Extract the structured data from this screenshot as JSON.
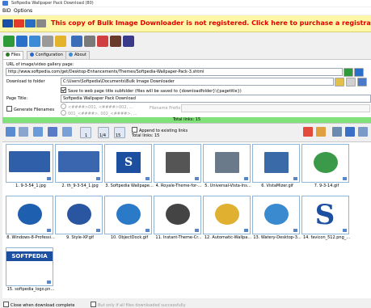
{
  "window": {
    "title": "Softpedia Wallpaper Pack Download (80)"
  },
  "menu": [
    "BID",
    "Options"
  ],
  "banner": {
    "message": "This copy of Bulk Image Downloader is not registered. Click here to purchase a registration code."
  },
  "tabs": [
    {
      "label": "Files"
    },
    {
      "label": "Configuration"
    },
    {
      "label": "About"
    }
  ],
  "form": {
    "url_label": "URL of image/video gallery page:",
    "url_value": "http://www.softpedia.com/get/Desktop-Enhancements/Themes/Softpedia-Wallpaper-Pack-3.shtml",
    "folder_label": "Download to folder",
    "folder_value": "C:\\Users\\Softpedia\\Documents\\Bulk Image Downloader",
    "subfolder_label": "Save to web page title subfolder (files will be saved to {downloadfolder}\\{pagetitle})",
    "page_title_label": "Page Title:",
    "page_title_value": "Softpedia Wallpaper Pack Download",
    "gen_label": "Generate Filenames",
    "opt1": "<####>001, <####>002, ...",
    "opt2": "001_<####>, 002_<####>, ...",
    "prefix_label": "Filename Prefix:"
  },
  "total_links": "Total links: 15",
  "view": {
    "append_label": "Append to existing links",
    "total_label": "Total links: 15",
    "n1": "1",
    "n2": "1/4",
    "n3": "15"
  },
  "thumbs": [
    {
      "caption": "1. 9-3-54_1.jpg"
    },
    {
      "caption": "2. th_9-3-54_1.jpg"
    },
    {
      "caption": "3. Softpedia Wallpape..."
    },
    {
      "caption": "4. Royale-Theme-for-..."
    },
    {
      "caption": "5. Universal-Vista-Ins..."
    },
    {
      "caption": "6. VistaMizer.gif"
    },
    {
      "caption": "7. 9-3-14.gif"
    },
    {
      "caption": "8. Windows-8-Professi..."
    },
    {
      "caption": "9. Style-XP.gif"
    },
    {
      "caption": "10. ObjectDock.gif"
    },
    {
      "caption": "11. Instant-Theme-Cr..."
    },
    {
      "caption": "12. Automatic-Wallpa..."
    },
    {
      "caption": "13. Watery-Desktop-3..."
    },
    {
      "caption": "14. favicon_512.png_..."
    },
    {
      "caption": "15. softpedia_logo.pn..."
    }
  ],
  "thumb_text": {
    "s_logo": "S",
    "softpedia_logo": "SOFTPEDIA"
  },
  "status": {
    "close_label": "Close when download complete",
    "only_label": "But only if all files downloaded successfully"
  }
}
